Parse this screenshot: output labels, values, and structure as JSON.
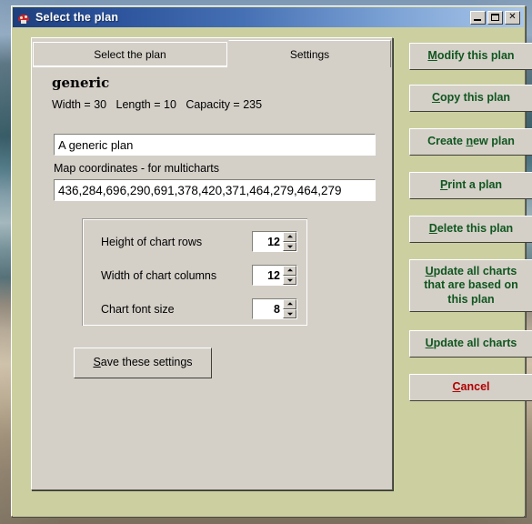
{
  "window": {
    "title": "Select the plan",
    "icon": "mushroom-icon",
    "controls": {
      "minimize": "_",
      "maximize": "□",
      "close": "✕"
    },
    "colors": {
      "titlebar_start": "#1e3f7d",
      "titlebar_end": "#a9c6e8",
      "panel": "#d4d0c8",
      "window_background": "#ccd0a0",
      "button_text_green": "#10561f",
      "cancel_text_red": "#b00000"
    }
  },
  "tabs": [
    {
      "label": "Select the plan",
      "active": false
    },
    {
      "label": "Settings",
      "active": true
    }
  ],
  "plan": {
    "name": "generic",
    "stats": "Width = 30   Length = 10   Capacity = 235",
    "description_value": "A generic plan",
    "coordinates_label": "Map coordinates - for multicharts",
    "coordinates_value": "436,284,696,290,691,378,420,371,464,279,464,279"
  },
  "settings": {
    "fields": [
      {
        "label": "Height of chart rows",
        "value": "12"
      },
      {
        "label": "Width of chart columns",
        "value": "12"
      },
      {
        "label": "Chart font size",
        "value": "8"
      }
    ],
    "save_button": {
      "accel": "S",
      "rest": "ave these settings"
    }
  },
  "actions": [
    {
      "accel": "M",
      "before": "",
      "after": "odify this plan"
    },
    {
      "accel": "C",
      "before": "",
      "after": "opy this plan"
    },
    {
      "accel": "n",
      "before": "Create ",
      "after": "ew plan"
    },
    {
      "accel": "P",
      "before": "",
      "after": "rint a plan"
    },
    {
      "accel": "D",
      "before": "",
      "after": "elete this plan"
    },
    {
      "accel": "U",
      "before": "",
      "after": "pdate all charts that are based on this plan"
    },
    {
      "accel": "U",
      "before": "",
      "after": "pdate all charts"
    },
    {
      "accel": "C",
      "before": "",
      "after": "ancel"
    }
  ]
}
